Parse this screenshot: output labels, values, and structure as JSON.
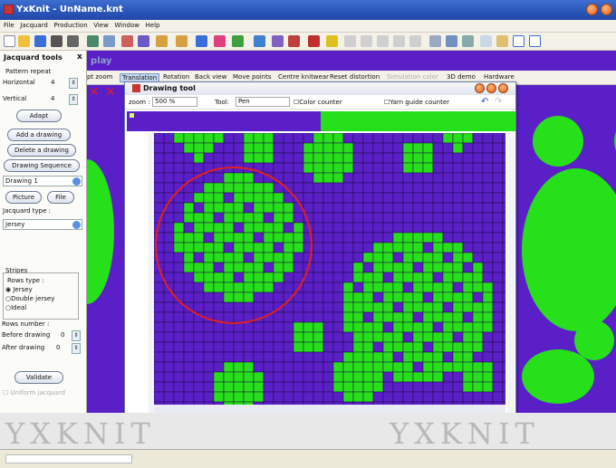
{
  "window": {
    "title": "YxKnit - UnName.knt"
  },
  "menu": [
    "File",
    "Jacquard",
    "Production",
    "View",
    "Window",
    "Help"
  ],
  "panel": {
    "header": "Jacquard tools",
    "close": "x",
    "pattern_repeat": "Pattern repeat",
    "horizontal_label": "Horizontal",
    "horizontal_value": "4",
    "vertical_label": "Vertical",
    "vertical_value": "4",
    "adapt": "Adapt",
    "add_drawing": "Add a drawing",
    "delete_drawing": "Delete a drawing",
    "drawing_sequence": "Drawing Sequence",
    "drawing_select": "Drawing 1",
    "picture": "Picture",
    "file": "File",
    "jacquard_type_label": "Jacquard type :",
    "jacquard_type_value": "Jersey",
    "stripes": "Stripes",
    "rows_type": "Rows type :",
    "row_options": [
      "Jersey",
      "Double jersey",
      "Ideal"
    ],
    "rows_number": "Rows number :",
    "before_label": "Before drawing",
    "before_value": "0",
    "after_label": "After drawing",
    "after_value": "0",
    "validate": "Validate",
    "uniform": "Uniform jacquard"
  },
  "knit": {
    "display_label": "play",
    "tabs": [
      "ipt zoom",
      "Translation",
      "Rotation",
      "Back view",
      "Move points",
      "Centre knitwear",
      "Reset distortion",
      "Simulation color",
      "3D demo",
      "Hardware"
    ]
  },
  "drawing_tool": {
    "title": "Drawing tool",
    "zoom_label": "zoom :",
    "zoom_value": "500 %",
    "tool_label": "Tool:",
    "tool_value": "Pen",
    "color_counter": "Color counter",
    "yarn_counter": "Yarn guide counter"
  },
  "footer_watermark": "YXKNIT",
  "colors": {
    "purple": "#5b1fc8",
    "green": "#26e01a",
    "accent": "#2a55b8",
    "highlight": "#e02020"
  }
}
